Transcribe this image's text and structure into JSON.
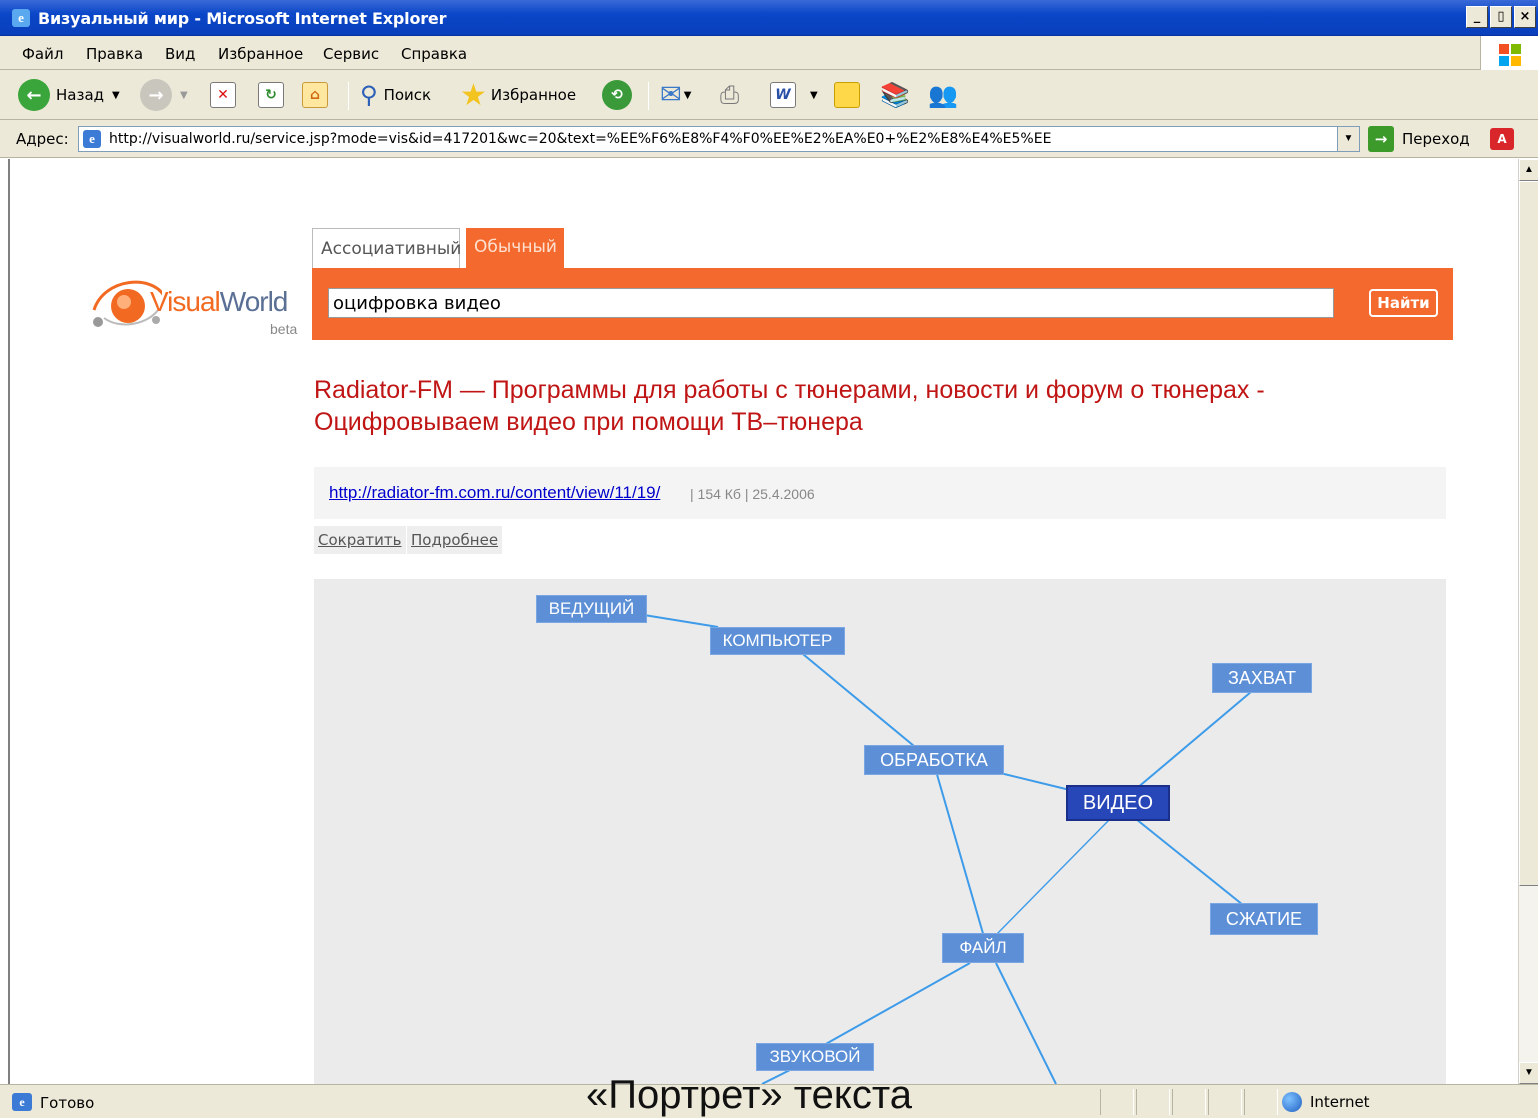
{
  "window": {
    "title": "Визуальный мир - Microsoft Internet Explorer",
    "controls": [
      "_",
      "▯",
      "×"
    ]
  },
  "menu": [
    "Файл",
    "Правка",
    "Вид",
    "Избранное",
    "Сервис",
    "Справка"
  ],
  "toolbar": {
    "back_label": "Назад",
    "search_label": "Поиск",
    "favorites_label": "Избранное"
  },
  "address": {
    "label": "Адрес:",
    "url": "http://visualworld.ru/service.jsp?mode=vis&id=417201&wc=20&text=%EE%F6%E8%F4%F0%EE%E2%EA%E0+%E2%E8%E4%E5%EE",
    "go_label": "Переход"
  },
  "logo": {
    "part1": "Visual",
    "part2": "World",
    "beta": "beta"
  },
  "tabs": {
    "associative": "Ассоциативный",
    "normal": "Обычный"
  },
  "search": {
    "query": "оцифровка видео",
    "button": "Найти"
  },
  "result": {
    "title": "Radiator-FM — Программы для работы с тюнерами, новости и форум о тюнерах - Оцифровываем видео при помощи ТВ–тюнера",
    "link": "http://radiator-fm.com.ru/content/view/11/19/",
    "info": "| 154 Кб | 25.4.2006",
    "shorten": "Сократить",
    "more": "Подробнее"
  },
  "graph": {
    "nodes": [
      {
        "id": "vedushchiy",
        "label": "ВЕДУЩИЙ"
      },
      {
        "id": "kompyuter",
        "label": "КОМПЬЮТЕР"
      },
      {
        "id": "zakhvat",
        "label": "ЗАХВАТ"
      },
      {
        "id": "obrabotka",
        "label": "ОБРАБОТКА"
      },
      {
        "id": "video",
        "label": "ВИДЕО"
      },
      {
        "id": "szhatie",
        "label": "СЖАТИЕ"
      },
      {
        "id": "fayl",
        "label": "ФАЙЛ"
      },
      {
        "id": "zvukovoy",
        "label": "ЗВУКОВОЙ"
      }
    ]
  },
  "status": {
    "text": "Готово",
    "zone": "Internet"
  },
  "caption": "«Портрет» текста",
  "colors": {
    "accent": "#f4692e",
    "title_red": "#c01515",
    "node": "#5c8fd6",
    "node_main": "#2747b8",
    "edge": "#3d9be9"
  }
}
